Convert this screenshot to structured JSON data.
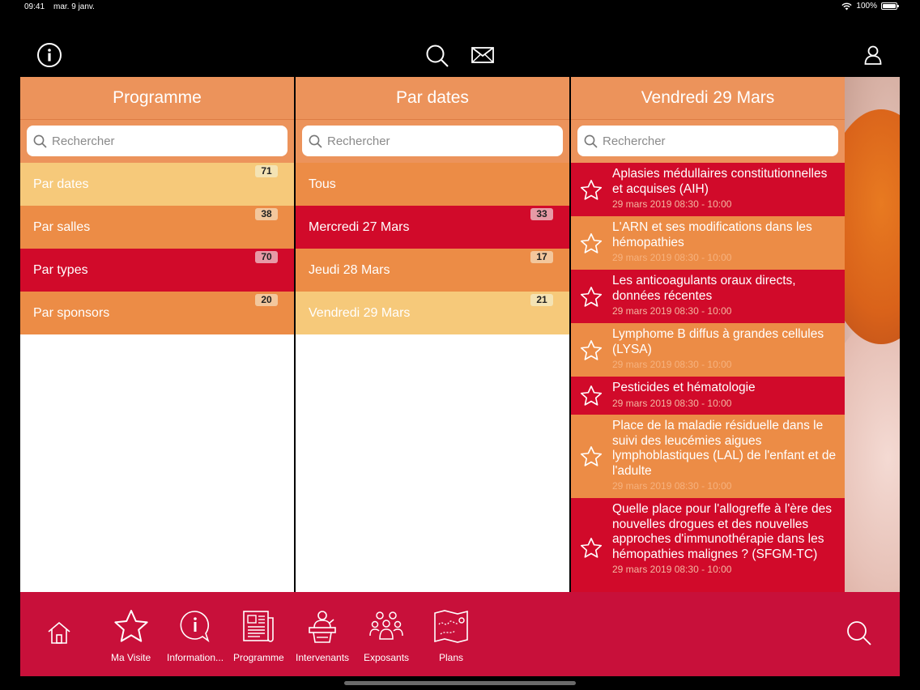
{
  "status_bar": {
    "time": "09:41",
    "date": "mar. 9 janv.",
    "battery": "100%"
  },
  "columns": {
    "programme": {
      "title": "Programme",
      "search_placeholder": "Rechercher",
      "items": [
        {
          "label": "Par dates",
          "count": "71",
          "color": "yellow"
        },
        {
          "label": "Par salles",
          "count": "38",
          "color": "orange"
        },
        {
          "label": "Par types",
          "count": "70",
          "color": "red"
        },
        {
          "label": "Par sponsors",
          "count": "20",
          "color": "orange"
        }
      ]
    },
    "dates": {
      "title": "Par dates",
      "search_placeholder": "Rechercher",
      "items": [
        {
          "label": "Tous",
          "count": "",
          "color": "orange"
        },
        {
          "label": "Mercredi 27 Mars",
          "count": "33",
          "color": "red"
        },
        {
          "label": "Jeudi 28 Mars",
          "count": "17",
          "color": "orange"
        },
        {
          "label": "Vendredi 29 Mars",
          "count": "21",
          "color": "yellow"
        }
      ]
    },
    "day": {
      "title": "Vendredi 29 Mars",
      "search_placeholder": "Rechercher",
      "sessions": [
        {
          "title": "Aplasies médullaires constitutionnelles et acquises (AIH)",
          "time": "29 mars 2019 08:30 - 10:00",
          "color": "red"
        },
        {
          "title": "L'ARN et ses modifications dans les hémopathies",
          "time": "29 mars 2019 08:30 - 10:00",
          "color": "orange"
        },
        {
          "title": "Les anticoagulants oraux directs, données récentes",
          "time": "29 mars 2019 08:30 - 10:00",
          "color": "red"
        },
        {
          "title": "Lymphome B diffus à grandes cellules (LYSA)",
          "time": "29 mars 2019 08:30 - 10:00",
          "color": "orange"
        },
        {
          "title": "Pesticides et hématologie",
          "time": "29 mars 2019 08:30 - 10:00",
          "color": "red"
        },
        {
          "title": "Place de la maladie résiduelle dans le suivi des leucémies aigues lymphoblastiques (LAL) de l'enfant et de l'adulte",
          "time": "29 mars 2019 08:30 - 10:00",
          "color": "orange"
        },
        {
          "title": "Quelle place pour l'allogreffe à l'ère des nouvelles drogues et des nouvelles approches d'immunothérapie dans les hémopathies malignes ? (SFGM-TC)",
          "time": "29 mars 2019 08:30 - 10:00",
          "color": "red"
        }
      ]
    }
  },
  "bottom_nav": {
    "tabs": [
      {
        "label": "",
        "icon": "home-icon"
      },
      {
        "label": "Ma Visite",
        "icon": "star-icon"
      },
      {
        "label": "Information...",
        "icon": "info-bubble-icon"
      },
      {
        "label": "Programme",
        "icon": "newspaper-icon"
      },
      {
        "label": "Intervenants",
        "icon": "speaker-icon"
      },
      {
        "label": "Exposants",
        "icon": "people-icon"
      },
      {
        "label": "Plans",
        "icon": "map-icon"
      }
    ]
  },
  "colors": {
    "header": "#ec935b",
    "yellow": "#f6c97a",
    "orange": "#ec8c46",
    "red": "#d10a2a",
    "nav": "#c8103a"
  }
}
